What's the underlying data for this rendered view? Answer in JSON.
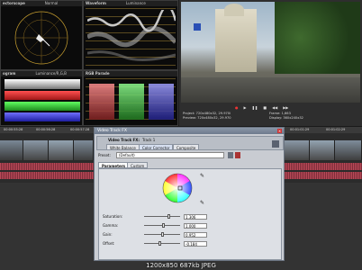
{
  "scopes": {
    "vectorscope": {
      "title": "ectorscope",
      "mode": "Normal"
    },
    "waveform": {
      "title": "Waveform",
      "mode": "Luminance"
    },
    "histogram": {
      "title": "ogram",
      "mode": "Luminance/R,G,B"
    },
    "parade": {
      "title": "RGB Parade"
    }
  },
  "preview": {
    "project_label": "Project:",
    "project_value": "720x480x32, 29.970i",
    "preview_label": "Preview:",
    "preview_value": "720x480x32, 29.970",
    "frame_label": "Frame:",
    "frame_value": "1,663",
    "display_label": "Display:",
    "display_value": "360x240x32"
  },
  "timeline": {
    "timecodes": [
      "00:00:55:28",
      "00:00:56:28",
      "00:00:57:28",
      "00:01:01:29",
      "00:01:02:29"
    ]
  },
  "fx_dialog": {
    "window_title": "Video Track FX",
    "chain_label": "Video Track FX:",
    "chain_track": "Track 1",
    "chain_items": [
      "White Balance",
      "Color Corrector",
      "Composite"
    ],
    "preset_label": "Preset:",
    "preset_value": "(Default)",
    "tabs": [
      "Parameters",
      "Custom"
    ],
    "params": [
      {
        "label": "Saturation:",
        "value": "1.306",
        "level": 0.65
      },
      {
        "label": "Gamma:",
        "value": "1.000",
        "level": 0.5
      },
      {
        "label": "Gain:",
        "value": "0.952",
        "level": 0.48
      },
      {
        "label": "Offset:",
        "value": "-0.184",
        "level": 0.4
      }
    ]
  },
  "image_info": "1200x850  687kb  JPEG",
  "colors": {
    "accent": "#4a6aa8",
    "title_bar": "#6d7a8d",
    "audio": "#b94a58"
  }
}
